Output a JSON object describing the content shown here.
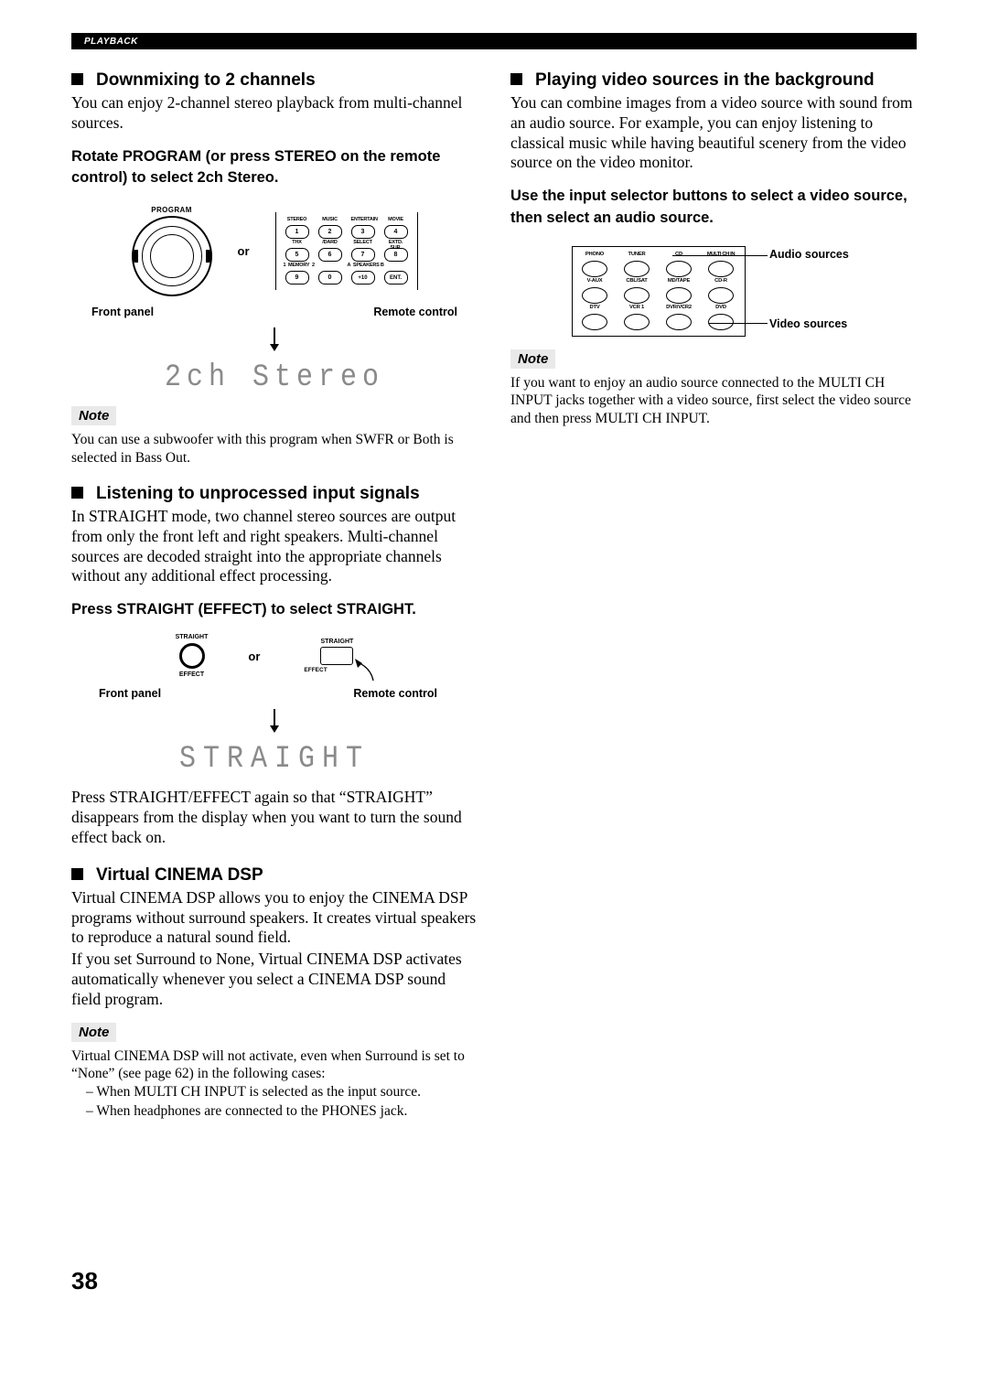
{
  "header": {
    "chip": "PLAYBACK"
  },
  "left": {
    "s1": {
      "title": "Downmixing to 2 channels",
      "p1": "You can enjoy 2-channel stereo playback from multi-channel sources.",
      "instr": "Rotate PROGRAM (or press STEREO on the remote control) to select 2ch Stereo.",
      "fig": {
        "dialLabel": "PROGRAM",
        "or": "or",
        "keypad": {
          "rows": [
            {
              "labels": [
                "STEREO",
                "MUSIC",
                "ENTERTAIN",
                "MOVIE"
              ],
              "nums": [
                "1",
                "2",
                "3",
                "4"
              ]
            },
            {
              "labels": [
                "THX",
                "/DARD",
                "SELECT",
                "EXTD. SUR."
              ],
              "nums": [
                "5",
                "6",
                "7",
                "8"
              ]
            },
            {
              "labels": [
                "1  MEMORY  2",
                "",
                "A  SPEAKERS B",
                ""
              ],
              "nums": [
                "9",
                "0",
                "+10",
                "ENT."
              ]
            }
          ]
        },
        "capLeft": "Front panel",
        "capRight": "Remote control",
        "lcd": "2ch Stereo"
      },
      "noteLabel": "Note",
      "note": "You can use a subwoofer with this program when SWFR or Both is selected in Bass Out."
    },
    "s2": {
      "title": "Listening to unprocessed input signals",
      "p1": "In STRAIGHT mode, two channel stereo sources are output from only the front left and right speakers. Multi-channel sources are decoded straight into the appropriate channels without any additional effect processing.",
      "instr": "Press STRAIGHT (EFFECT) to select STRAIGHT.",
      "fig": {
        "fpTop": "STRAIGHT",
        "fpBot": "EFFECT",
        "or": "or",
        "rcTop": "STRAIGHT",
        "rcBot": "EFFECT",
        "capLeft": "Front panel",
        "capRight": "Remote control",
        "lcd": "STRAIGHT"
      },
      "p2": "Press STRAIGHT/EFFECT again so that “STRAIGHT” disappears from the display when you want to turn the sound effect back on."
    },
    "s3": {
      "title": "Virtual CINEMA DSP",
      "p1": "Virtual CINEMA DSP allows you to enjoy the CINEMA DSP programs without surround speakers. It creates virtual speakers to reproduce a natural sound field.",
      "p2": "If you set Surround to None, Virtual CINEMA DSP activates automatically whenever you select a CINEMA DSP sound field program.",
      "noteLabel": "Note",
      "note": "Virtual CINEMA DSP will not activate, even when Surround is set to “None” (see page 62) in the following cases:",
      "b1": "– When MULTI CH INPUT is selected as the input source.",
      "b2": "– When headphones are connected to the PHONES jack."
    }
  },
  "right": {
    "s1": {
      "title": "Playing video sources in the background",
      "p1": "You can combine images from a video source with sound from an audio source. For example, you can enjoy listening to classical music while having beautiful scenery from the video source on the video monitor.",
      "instr": "Use the input selector buttons to select a video source, then select an audio source.",
      "fig": {
        "audioLabel": "Audio sources",
        "videoLabel": "Video sources",
        "rows": [
          [
            "PHONO",
            "TUNER",
            "CD",
            "MULTI CH IN"
          ],
          [
            "V-AUX",
            "CBL/SAT",
            "MD/TAPE",
            "CD-R"
          ],
          [
            "DTV",
            "VCR 1",
            "DVR/VCR2",
            "DVD"
          ]
        ]
      },
      "noteLabel": "Note",
      "note": "If you want to enjoy an audio source connected to the MULTI CH INPUT jacks together with a video source, first select the video source and then press MULTI CH INPUT."
    }
  },
  "pageNum": "38"
}
